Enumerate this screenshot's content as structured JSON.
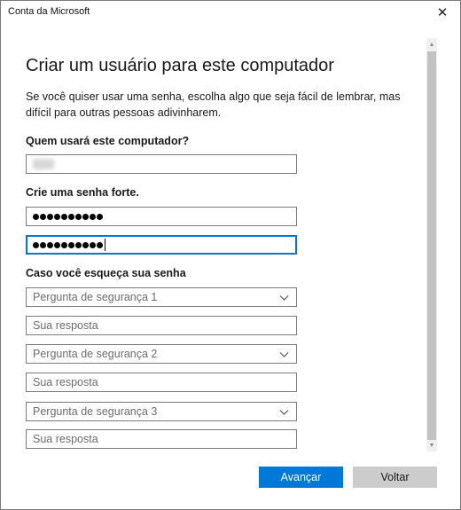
{
  "window": {
    "title": "Conta da Microsoft",
    "close_glyph": "✕"
  },
  "page": {
    "heading": "Criar um usuário para este computador",
    "description": "Se você quiser usar uma senha, escolha algo que seja fácil de lembrar, mas difícil para outras pessoas adivinharem."
  },
  "user_section": {
    "label": "Quem usará este computador?"
  },
  "password_section": {
    "label": "Crie uma senha forte.",
    "password_length": 10,
    "confirm_length": 10
  },
  "recovery_section": {
    "label": "Caso você esqueça sua senha",
    "questions": [
      {
        "select_placeholder": "Pergunta de segurança 1",
        "answer_placeholder": "Sua resposta"
      },
      {
        "select_placeholder": "Pergunta de segurança 2",
        "answer_placeholder": "Sua resposta"
      },
      {
        "select_placeholder": "Pergunta de segurança 3",
        "answer_placeholder": "Sua resposta"
      }
    ]
  },
  "buttons": {
    "next": "Avançar",
    "back": "Voltar"
  },
  "colors": {
    "accent": "#0078d7",
    "secondary_button": "#cccccc"
  },
  "icons": {
    "close": "close-icon",
    "dropdown": "chevron-down-icon",
    "scroll_up": "scroll-up-arrow-icon",
    "scroll_down": "scroll-down-arrow-icon"
  }
}
